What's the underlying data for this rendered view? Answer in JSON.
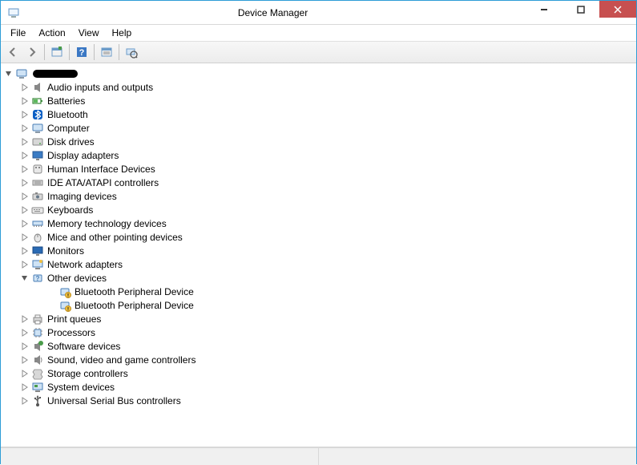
{
  "window": {
    "title": "Device Manager"
  },
  "menu": {
    "file": "File",
    "action": "Action",
    "view": "View",
    "help": "Help"
  },
  "tree": {
    "root": {
      "label": "",
      "redacted": true,
      "icon": "computer",
      "expanded": true
    },
    "categories": [
      {
        "label": "Audio inputs and outputs",
        "icon": "speaker",
        "expanded": false
      },
      {
        "label": "Batteries",
        "icon": "battery",
        "expanded": false
      },
      {
        "label": "Bluetooth",
        "icon": "bluetooth",
        "expanded": false
      },
      {
        "label": "Computer",
        "icon": "computer",
        "expanded": false
      },
      {
        "label": "Disk drives",
        "icon": "disk",
        "expanded": false
      },
      {
        "label": "Display adapters",
        "icon": "display",
        "expanded": false
      },
      {
        "label": "Human Interface Devices",
        "icon": "hid",
        "expanded": false
      },
      {
        "label": "IDE ATA/ATAPI controllers",
        "icon": "ide",
        "expanded": false
      },
      {
        "label": "Imaging devices",
        "icon": "imaging",
        "expanded": false
      },
      {
        "label": "Keyboards",
        "icon": "keyboard",
        "expanded": false
      },
      {
        "label": "Memory technology devices",
        "icon": "memory",
        "expanded": false
      },
      {
        "label": "Mice and other pointing devices",
        "icon": "mouse",
        "expanded": false
      },
      {
        "label": "Monitors",
        "icon": "monitor",
        "expanded": false
      },
      {
        "label": "Network adapters",
        "icon": "network",
        "expanded": false
      },
      {
        "label": "Other devices",
        "icon": "other",
        "expanded": true,
        "children": [
          {
            "label": "Bluetooth Peripheral Device",
            "icon": "unknown"
          },
          {
            "label": "Bluetooth Peripheral Device",
            "icon": "unknown"
          }
        ]
      },
      {
        "label": "Print queues",
        "icon": "printer",
        "expanded": false
      },
      {
        "label": "Processors",
        "icon": "cpu",
        "expanded": false
      },
      {
        "label": "Software devices",
        "icon": "software",
        "expanded": false
      },
      {
        "label": "Sound, video and game controllers",
        "icon": "sound",
        "expanded": false
      },
      {
        "label": "Storage controllers",
        "icon": "storage",
        "expanded": false
      },
      {
        "label": "System devices",
        "icon": "system",
        "expanded": false
      },
      {
        "label": "Universal Serial Bus controllers",
        "icon": "usb",
        "expanded": false
      }
    ]
  }
}
